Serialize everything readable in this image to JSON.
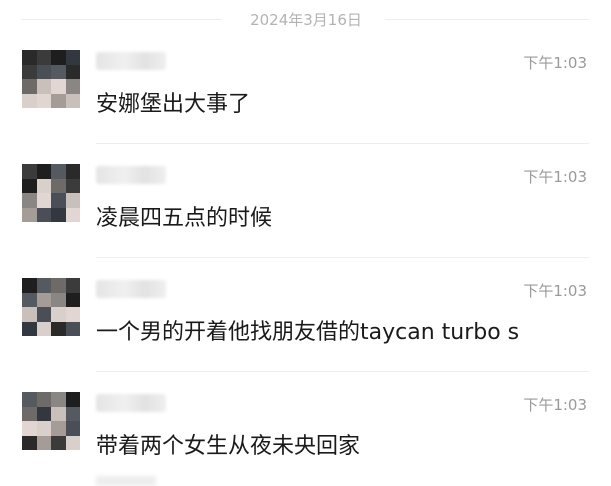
{
  "date_divider": "2024年3月16日",
  "messages": [
    {
      "time": "下午1:03",
      "text": "安娜堡出大事了"
    },
    {
      "time": "下午1:03",
      "text": "凌晨四五点的时候"
    },
    {
      "time": "下午1:03",
      "text": "一个男的开着他找朋友借的taycan turbo s"
    },
    {
      "time": "下午1:03",
      "text": "带着两个女生从夜未央回家"
    }
  ],
  "colors": {
    "time_text": "#9a9a9a",
    "message_text": "#1a1a1a",
    "divider_text": "#b3b3b3"
  }
}
